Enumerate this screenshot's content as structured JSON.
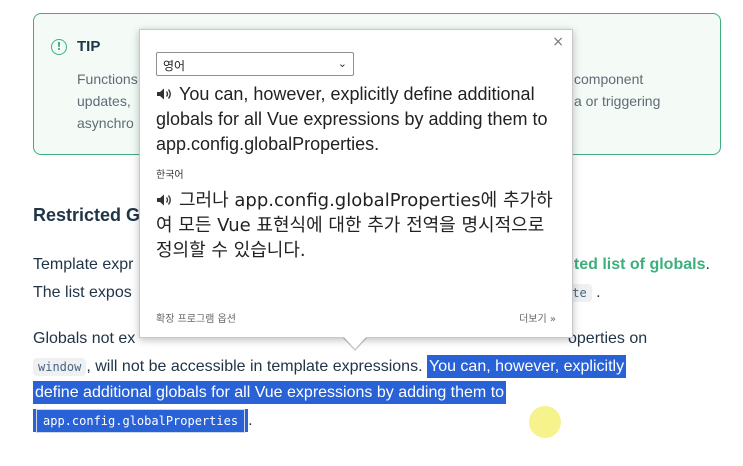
{
  "tip": {
    "title": "TIP",
    "line1_left": "Functions",
    "line1_right": "component",
    "line2_left": "updates,",
    "line2_right": "a or triggering",
    "line3_left": "asynchro"
  },
  "section": {
    "heading": "Restricted G",
    "p1_line1_left": "Template expr",
    "p1_line1_link": "cted list of globals",
    "p1_line1_end": ".",
    "p1_line2_left": "The list expos",
    "p1_line2_code": "ate",
    "p1_line2_end": ".",
    "p2_line1_left": "Globals not ex",
    "p2_line1_right": "operties on",
    "p2_line2_code": "window",
    "p2_line2_text": ", will not be accessible in template expressions.",
    "p2_line2_selected": "You can, however, explicitly",
    "p2_line3_selected": "define additional globals for all Vue expressions by adding them to",
    "p2_line4_code": "app.config.globalProperties",
    "p2_line4_end": "."
  },
  "popup": {
    "source_language": "영어",
    "source_text": "You can, however, explicitly define additional globals for all Vue expressions by adding them to app.config.globalProperties.",
    "target_language_label": "한국어",
    "target_text": "그러나 app.config.globalProperties에 추가하여 모든 Vue 표현식에 대한 추가 전역을 명시적으로 정의할 수 있습니다.",
    "extension_options_label": "확장 프로그램 옵션",
    "more_label": "더보기 »",
    "close_label": "×"
  },
  "colors": {
    "accent_green": "#3eaf7c",
    "selection_blue": "#2961d6"
  }
}
